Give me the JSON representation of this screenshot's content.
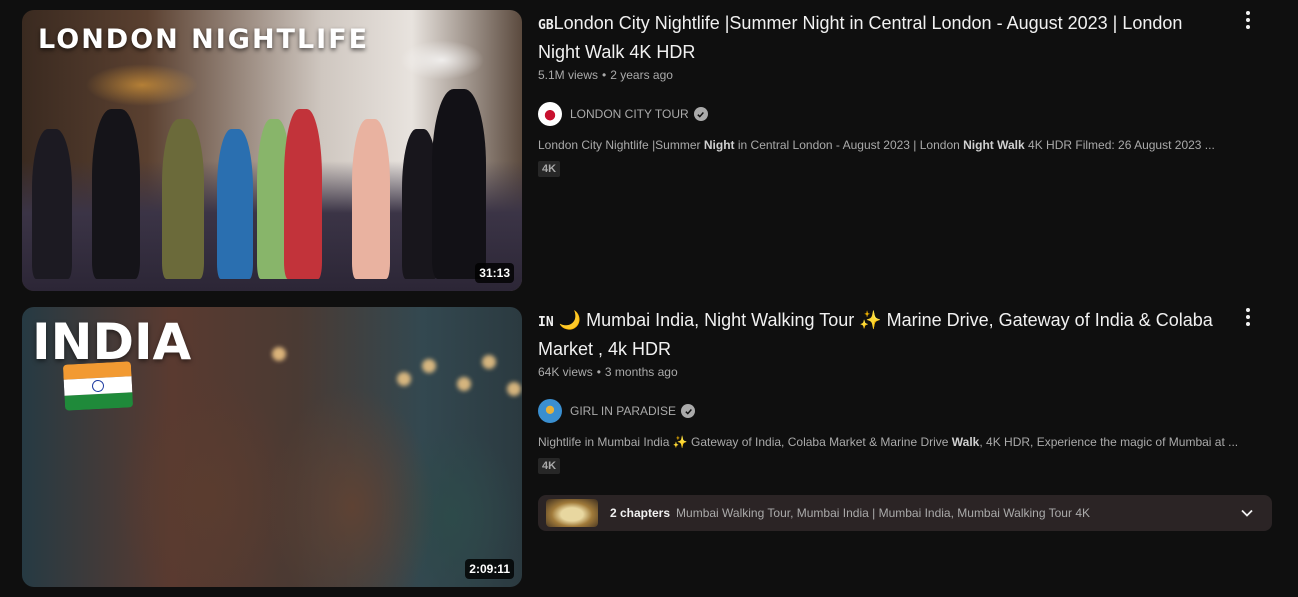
{
  "results": [
    {
      "thumbnail_text": "LONDON NIGHTLIFE",
      "duration": "31:13",
      "flag_code": "GB",
      "title": "London City Nightlife |Summer Night in Central London - August 2023 | London Night Walk 4K HDR",
      "views": "5.1M views",
      "age": "2 years ago",
      "channel": "LONDON CITY TOUR",
      "description": {
        "p1": "London City Nightlife |Summer ",
        "b1": "Night",
        "p2": " in Central London - August 2023 | London ",
        "b2": "Night Walk",
        "p3": " 4K HDR Filmed: 26 August 2023 ..."
      },
      "badge": "4K"
    },
    {
      "thumbnail_text": "INDIA",
      "duration": "2:09:11",
      "flag_code": "IN",
      "title": "🌙 Mumbai India, Night Walking Tour ✨ Marine Drive, Gateway of India & Colaba Market , 4k HDR",
      "views": "64K views",
      "age": "3 months ago",
      "channel": "GIRL IN PARADISE",
      "description": {
        "p1": "Nightlife in Mumbai India  ✨ Gateway of India, Colaba Market & Marine Drive ",
        "b1": "Walk",
        "p2": ", 4K HDR, Experience the magic of Mumbai at ..."
      },
      "badge": "4K",
      "chapters": {
        "label": "2 chapters",
        "list": "Mumbai Walking Tour, Mumbai India | Mumbai India, Mumbai Walking Tour 4K"
      }
    }
  ],
  "colors": {
    "background": "#0f0f0f",
    "primary_text": "#f1f1f1",
    "secondary_text": "#aaaaaa",
    "chapters_bg": "#2b2425"
  },
  "icons": [
    "three-dot-menu-icon",
    "verified-check-icon",
    "chevron-down-icon",
    "india-flag-icon"
  ]
}
